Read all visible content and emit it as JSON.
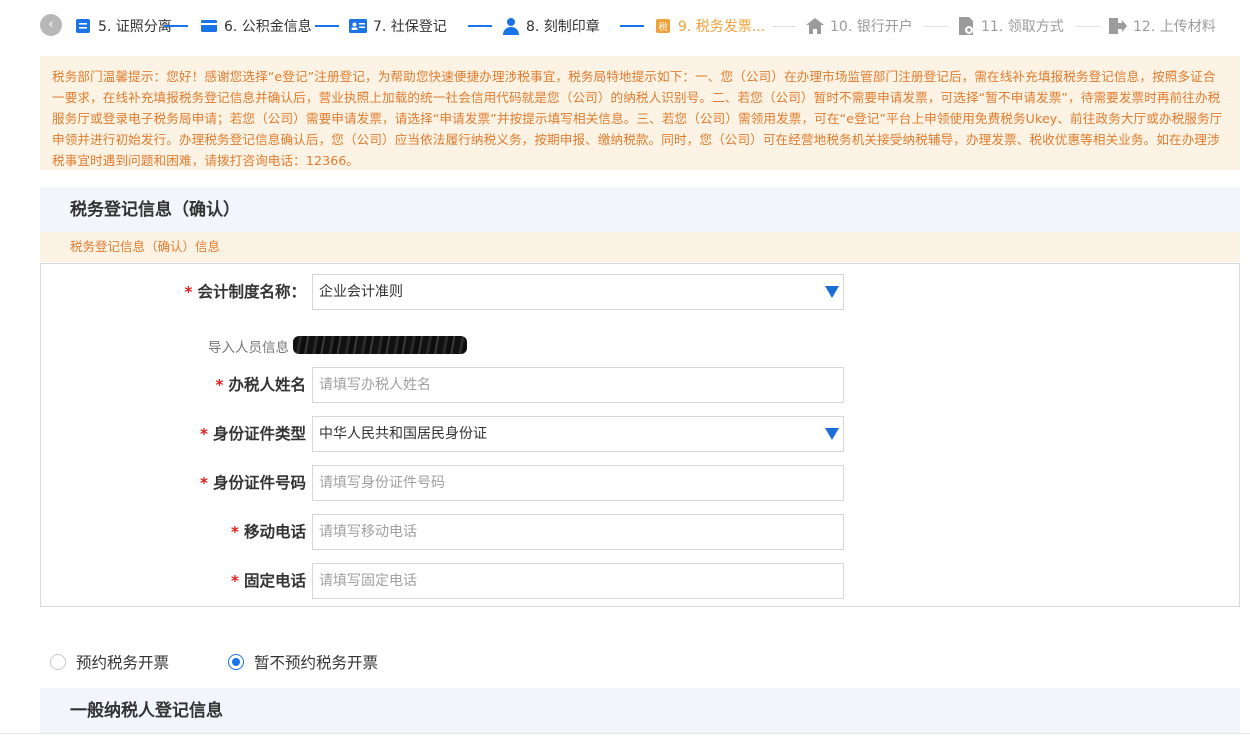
{
  "steps": [
    {
      "label": "5. 证照分离",
      "icon": "document-list-icon",
      "state": "done"
    },
    {
      "label": "6. 公积金信息",
      "icon": "card-icon",
      "state": "done"
    },
    {
      "label": "7. 社保登记",
      "icon": "id-card-icon",
      "state": "done"
    },
    {
      "label": "8. 刻制印章",
      "icon": "person-icon",
      "state": "done"
    },
    {
      "label": "9. 税务发票...",
      "icon": "tax-invoice-icon",
      "state": "current"
    },
    {
      "label": "10. 银行开户",
      "icon": "bank-icon",
      "state": "todo"
    },
    {
      "label": "11. 领取方式",
      "icon": "receipt-icon",
      "state": "todo"
    },
    {
      "label": "12. 上传材料",
      "icon": "upload-exit-icon",
      "state": "todo"
    }
  ],
  "notice": "税务部门温馨提示：您好！感谢您选择“e登记”注册登记，为帮助您快速便捷办理涉税事宜，税务局特地提示如下：一、您（公司）在办理市场监管部门注册登记后，需在线补充填报税务登记信息，按照多证合一要求，在线补充填报税务登记信息并确认后，营业执照上加载的统一社会信用代码就是您（公司）的纳税人识别号。二、若您（公司）暂时不需要申请发票，可选择“暂不申请发票”，待需要发票时再前往办税服务厅或登录电子税务局申请；若您（公司）需要申请发票，请选择“申请发票”并按提示填写相关信息。三、若您（公司）需领用发票，可在“e登记”平台上申领使用免费税务Ukey、前往政务大厅或办税服务厅申领并进行初始发行。办理税务登记信息确认后，您（公司）应当依法履行纳税义务，按期申报、缴纳税款。同时，您（公司）可在经营地税务机关接受纳税辅导，办理发票、税收优惠等相关业务。如在办理涉税事宜时遇到问题和困难，请拨打咨询电话：12366。",
  "section_title": "税务登记信息（确认）",
  "section_subtitle": "税务登记信息（确认）信息",
  "form": {
    "accounting_label": "会计制度名称：",
    "accounting_value": "企业会计准则",
    "import_label": "导入人员信息",
    "taxer_label": "办税人姓名",
    "taxer_placeholder": "请填写办税人姓名",
    "id_type_label": "身份证件类型",
    "id_type_value": "中华人民共和国居民身份证",
    "id_no_label": "身份证件号码",
    "id_no_placeholder": "请填写身份证件号码",
    "mobile_label": "移动电话",
    "mobile_placeholder": "请填写移动电话",
    "phone_label": "固定电话",
    "phone_placeholder": "请填写固定电话",
    "required_mark": "*"
  },
  "radios": {
    "option1": "预约税务开票",
    "option2": "暂不预约税务开票",
    "selected": "option2"
  },
  "general_section_title": "一般纳税人登记信息",
  "colors": {
    "accent": "#1a73e8",
    "current_step": "#f0a23a",
    "notice_text": "#e07c2f",
    "notice_bg": "#fdf3e4",
    "required": "#e02020"
  }
}
